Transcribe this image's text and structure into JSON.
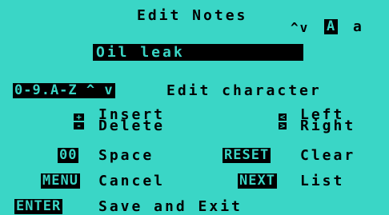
{
  "header": {
    "title": "Edit Notes",
    "case_arrows": "^v",
    "upper_case_key": "A",
    "lower_case_key": "a"
  },
  "note_input": {
    "value": "Oil leak"
  },
  "char_row": {
    "key": "0-9.A-Z ^ v",
    "label": "Edit character"
  },
  "controls": {
    "insert_key": "+",
    "insert_label": "Insert",
    "delete_key": "-",
    "delete_label": "Delete",
    "left_key": "<",
    "left_label": "Left",
    "right_key": ">",
    "right_label": "Right",
    "space_key": "00",
    "space_label": "Space",
    "reset_key": "RESET",
    "reset_label": "Clear",
    "menu_key": "MENU",
    "menu_label": "Cancel",
    "next_key": "NEXT",
    "next_label": "List",
    "enter_key": "ENTER",
    "enter_label": "Save and Exit"
  }
}
